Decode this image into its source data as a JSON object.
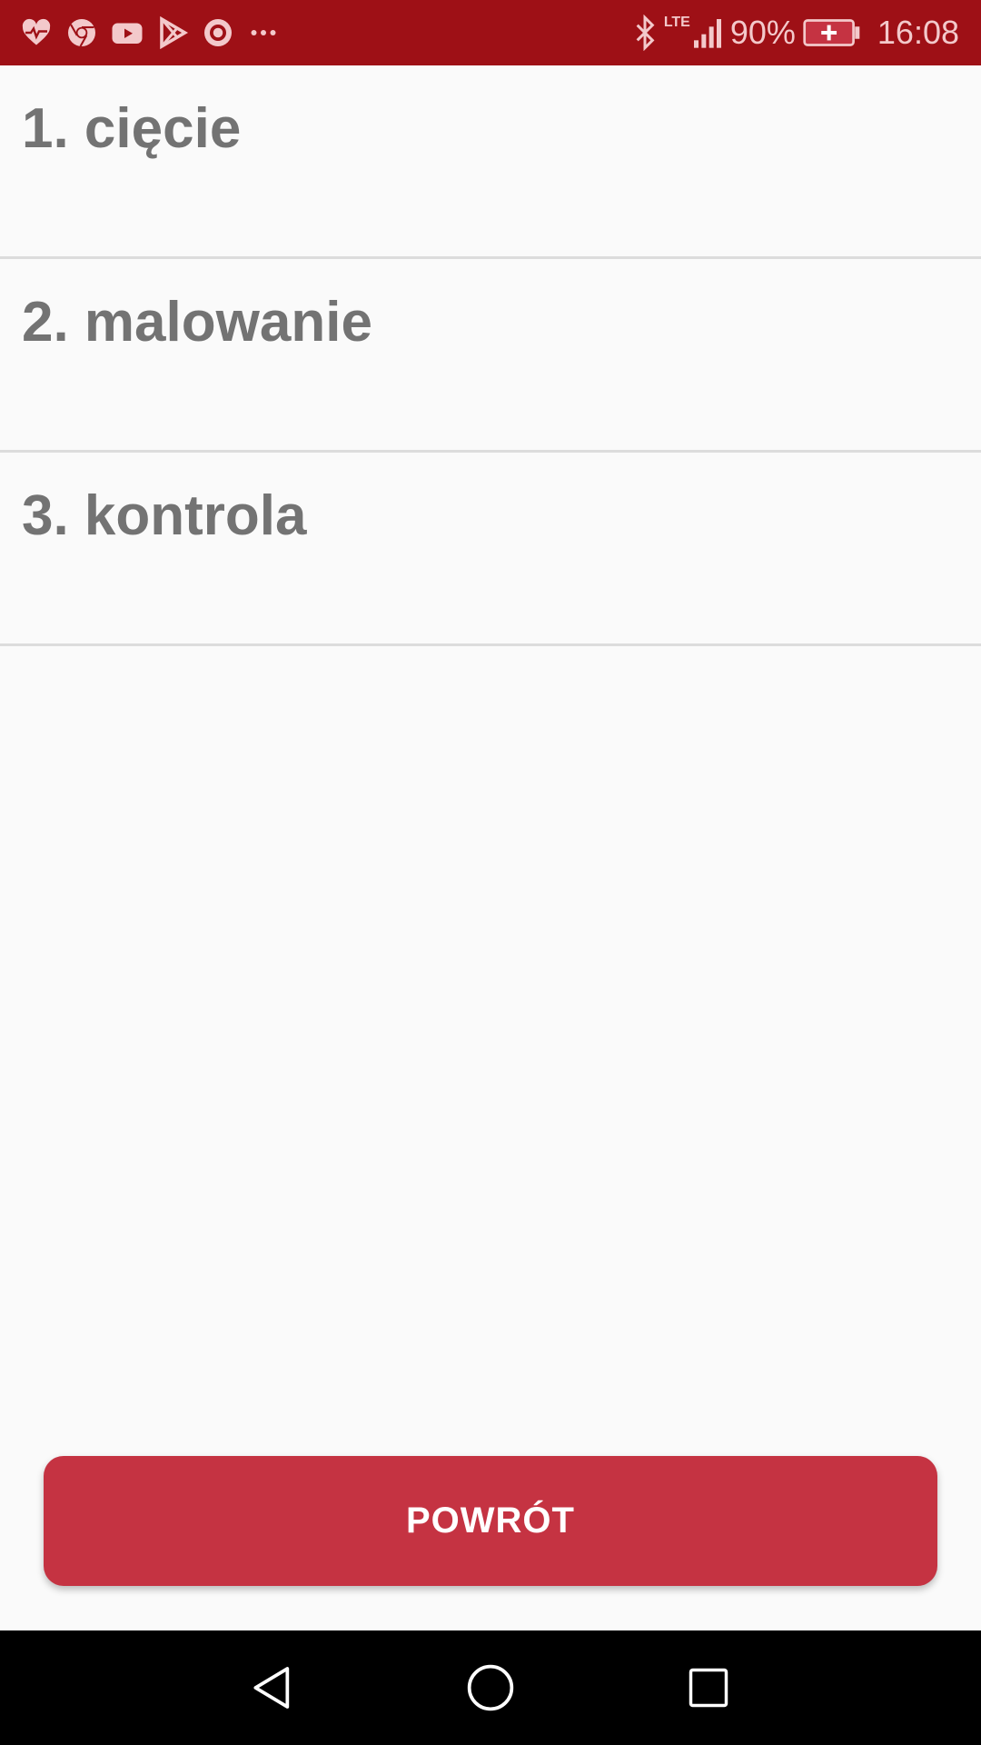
{
  "status_bar": {
    "background": "#9e1016",
    "left_icons": [
      "heart-rate-icon",
      "chrome-icon",
      "youtube-icon",
      "play-store-icon",
      "record-icon",
      "more-notifications-icon"
    ],
    "network_label": "LTE",
    "battery_percent": "90%",
    "time": "16:08"
  },
  "list": {
    "items": [
      {
        "label": "1. cięcie"
      },
      {
        "label": "2. malowanie"
      },
      {
        "label": "3. kontrola"
      }
    ]
  },
  "back_button": {
    "label": "POWRÓT",
    "color": "#c53342"
  },
  "nav_bar": {
    "buttons": [
      "back-triangle-icon",
      "home-circle-icon",
      "recent-apps-square-icon"
    ]
  }
}
